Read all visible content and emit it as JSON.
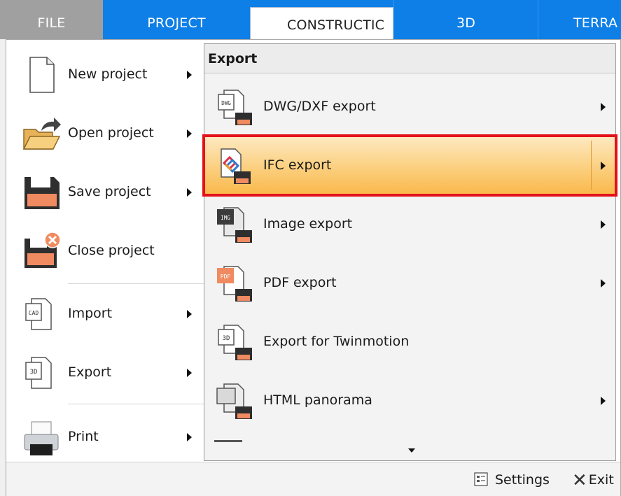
{
  "tabs": {
    "file": "FILE",
    "project": "PROJECT",
    "construction": "CONSTRUCTIC",
    "three_d": "3D",
    "terrain": "TERRA"
  },
  "left_menu": {
    "new_project": "New project",
    "open_project": "Open project",
    "save_project": "Save project",
    "close_project": "Close project",
    "import": "Import",
    "export": "Export",
    "print": "Print"
  },
  "submenu": {
    "header": "Export",
    "dwg": "DWG/DXF export",
    "ifc": "IFC export",
    "image": "Image export",
    "pdf": "PDF export",
    "twinmotion": "Export for Twinmotion",
    "html_panorama": "HTML panorama"
  },
  "icon_text": {
    "dwg": "DWG",
    "img": "IMG",
    "pdf": "PDF",
    "threed": "3D",
    "cad": "CAD"
  },
  "bottom": {
    "settings": "Settings",
    "exit": "Exit"
  },
  "colors": {
    "ribbon_blue": "#0e7fe6",
    "highlight_border": "#e3111b",
    "hover_orange": "#f9b84a",
    "floppy_accent": "#f08a60"
  }
}
